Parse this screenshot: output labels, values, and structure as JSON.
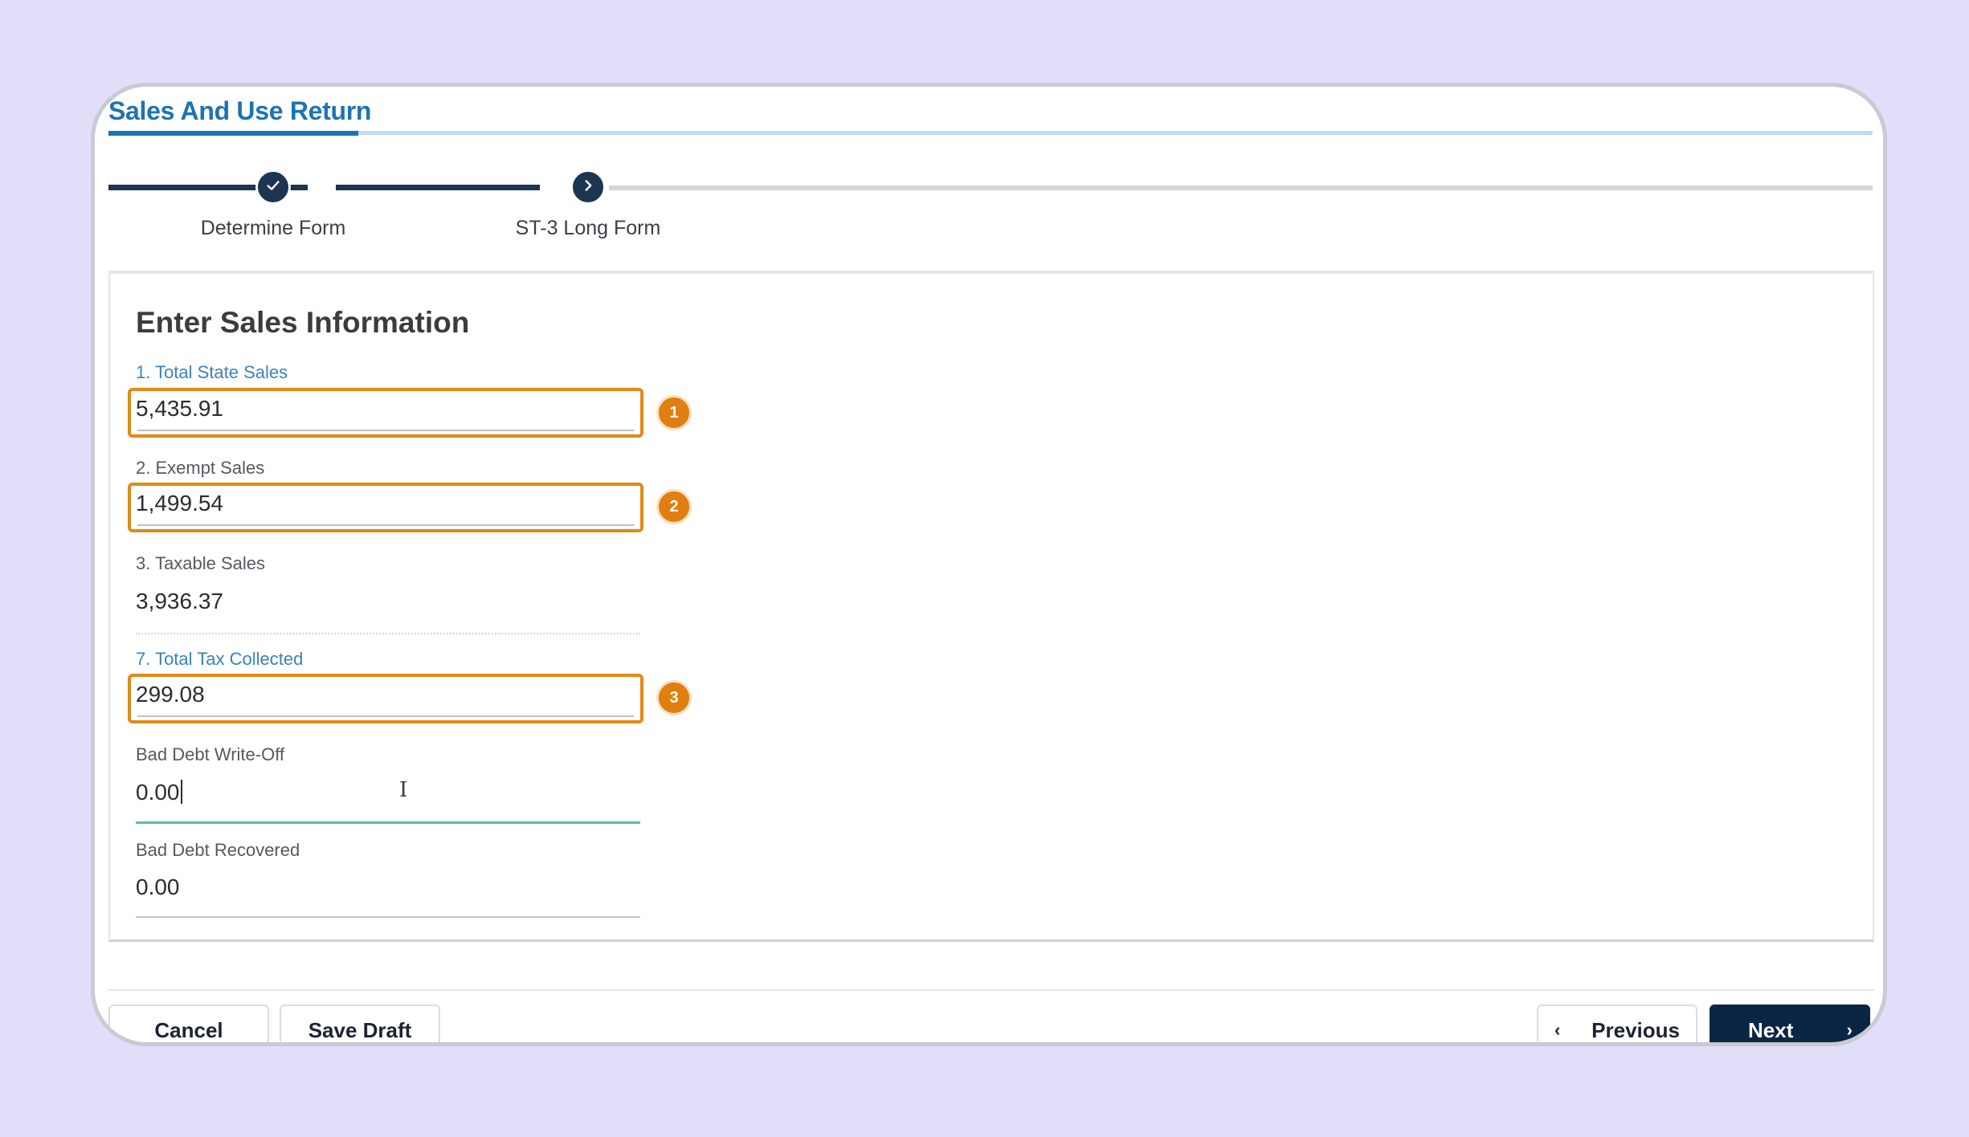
{
  "header": {
    "title": "Sales And Use Return"
  },
  "stepper": {
    "steps": [
      {
        "label": "Determine Form",
        "state": "complete",
        "icon": "check-icon"
      },
      {
        "label": "ST-3 Long Form",
        "state": "current",
        "icon": "chevron-right-icon"
      }
    ]
  },
  "form": {
    "title": "Enter Sales Information",
    "fields": {
      "total_state_sales": {
        "label": "1. Total State Sales",
        "value": "5,435.91",
        "badge": "1"
      },
      "exempt_sales": {
        "label": "2. Exempt Sales",
        "value": "1,499.54",
        "badge": "2"
      },
      "taxable_sales": {
        "label": "3. Taxable Sales",
        "value": "3,936.37"
      },
      "total_tax_collected": {
        "label": "7. Total Tax Collected",
        "value": "299.08",
        "badge": "3"
      },
      "bad_debt_write_off": {
        "label": "Bad Debt Write-Off",
        "value": "0.00"
      },
      "bad_debt_recovered": {
        "label": "Bad Debt Recovered",
        "value": "0.00"
      }
    }
  },
  "footer": {
    "cancel_label": "Cancel",
    "save_draft_label": "Save Draft",
    "previous_label": "Previous",
    "next_label": "Next"
  },
  "colors": {
    "accent": "#1d73b4",
    "highlight": "#e08a17",
    "primary_button": "#0b2545",
    "focus": "#56c29a"
  }
}
